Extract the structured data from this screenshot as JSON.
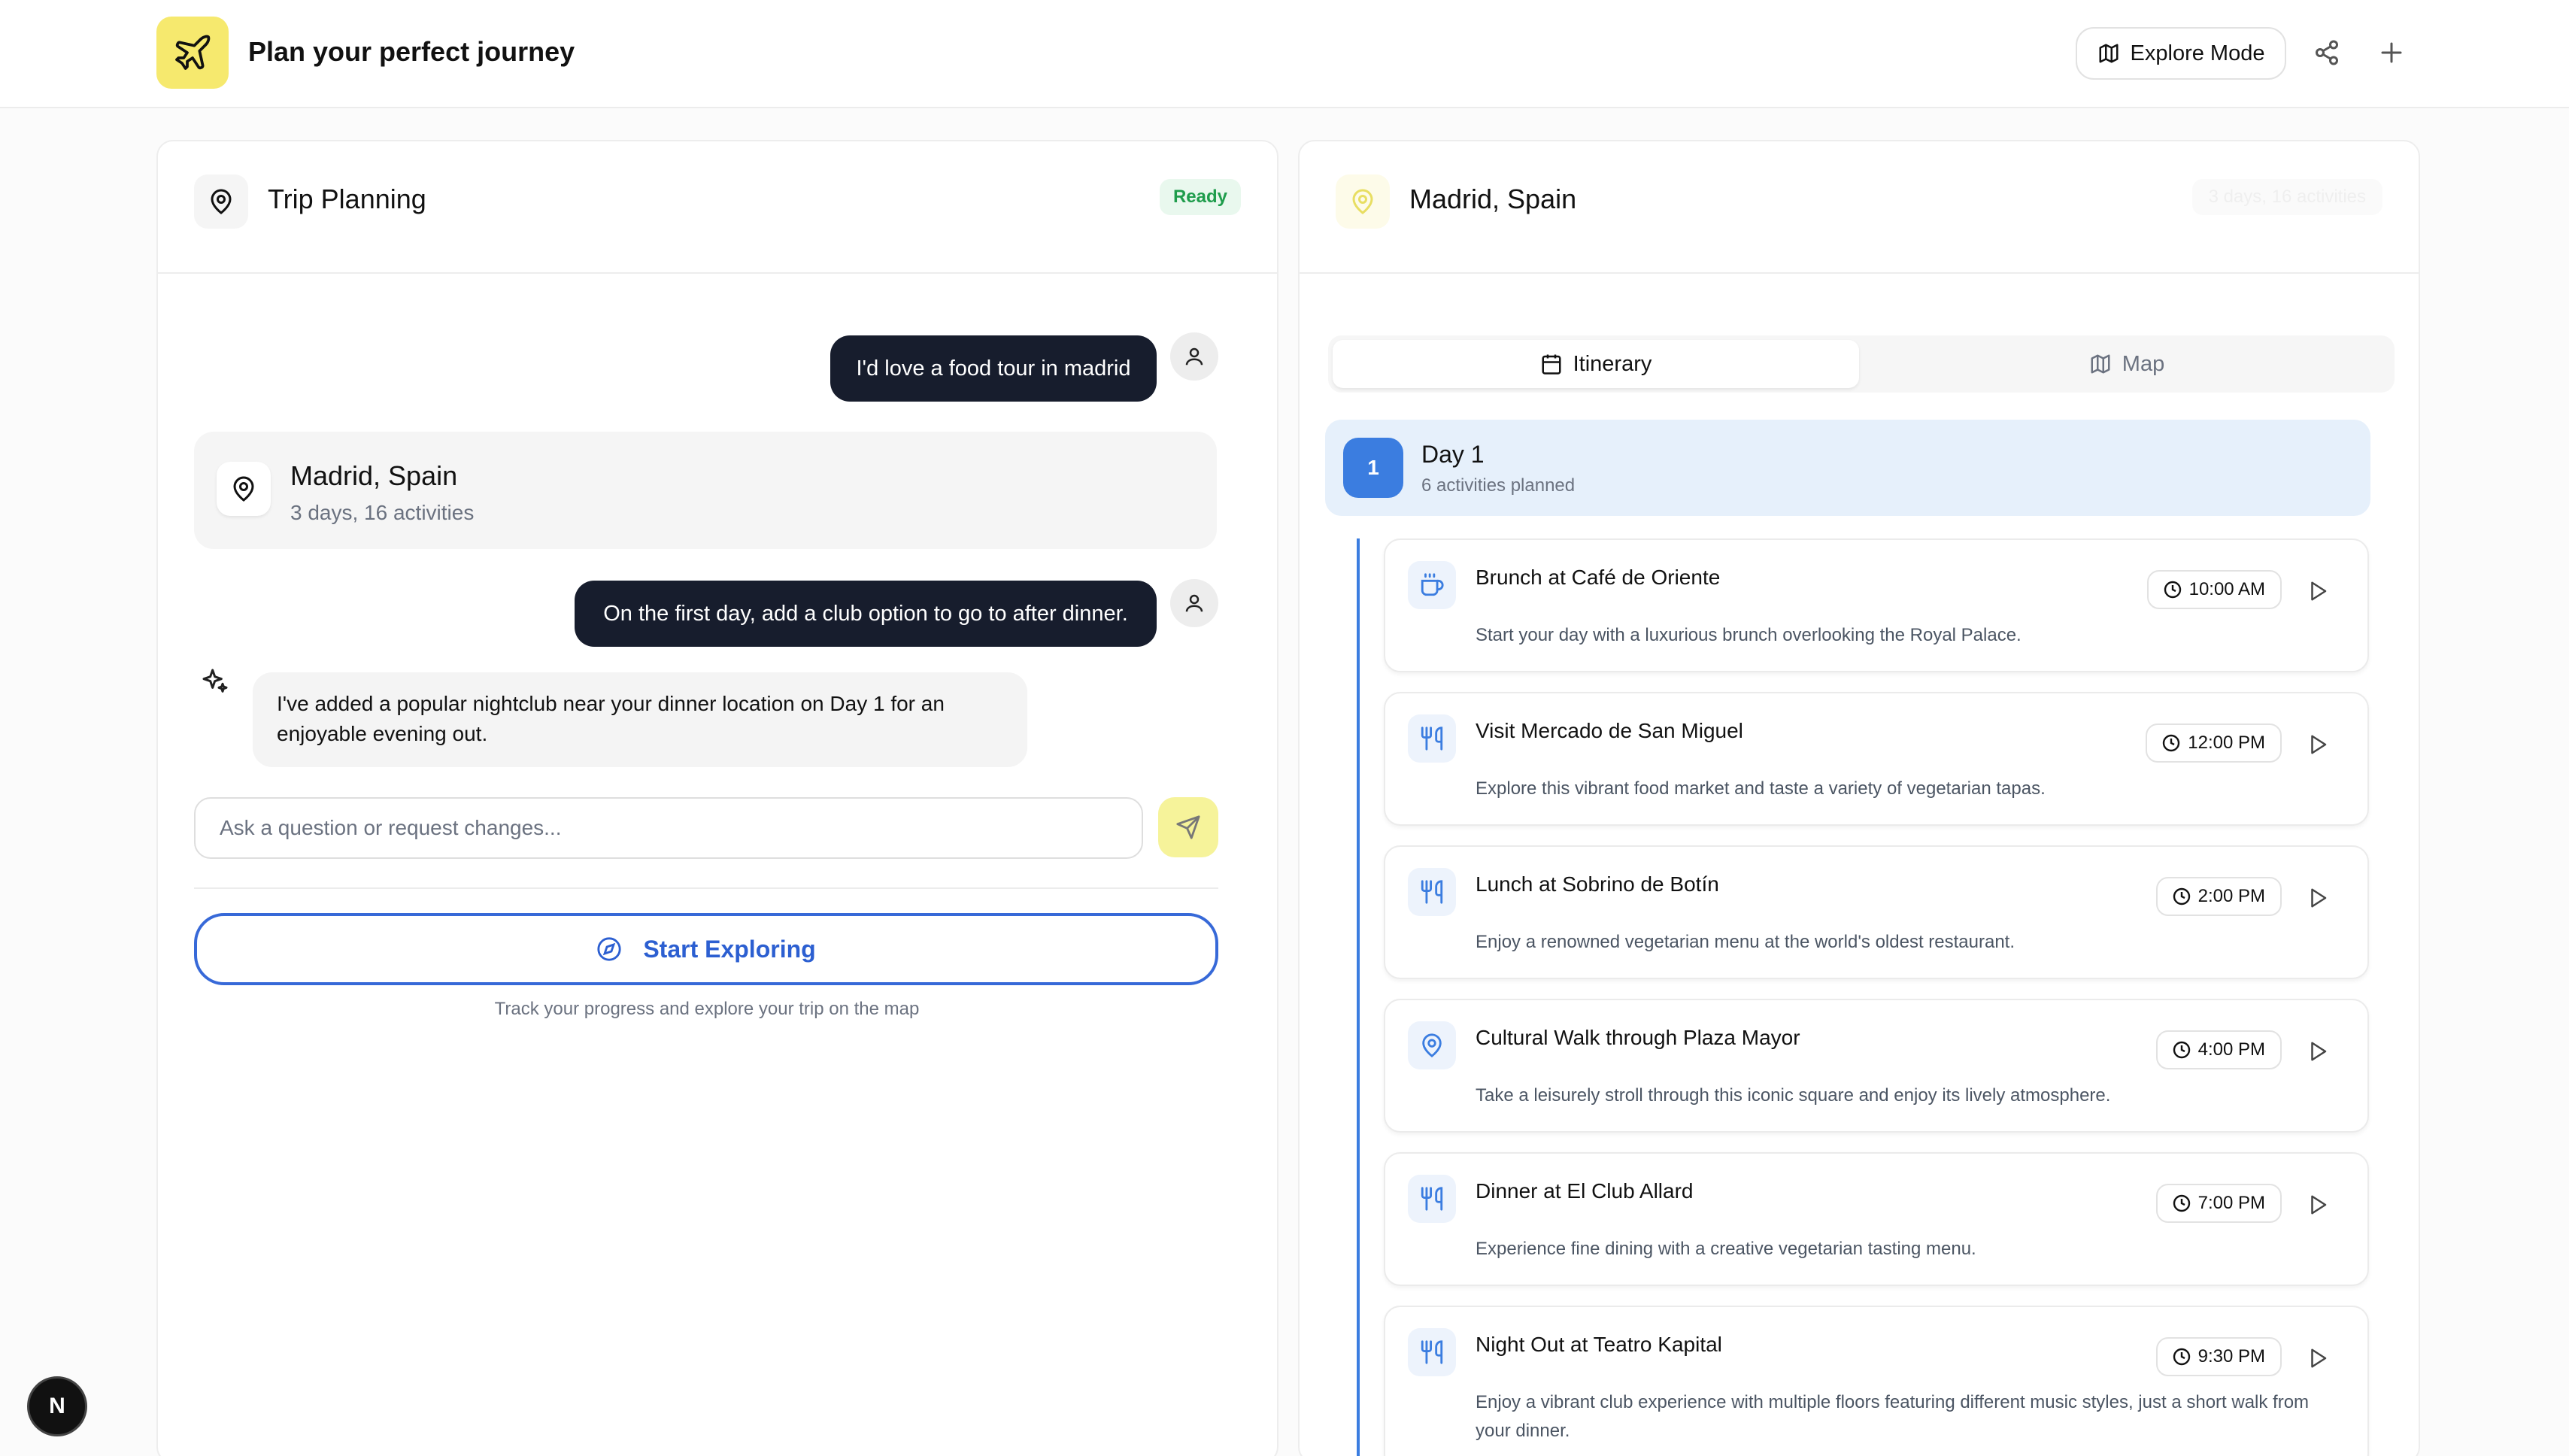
{
  "header": {
    "title": "Plan your perfect journey",
    "explore_mode_label": "Explore Mode",
    "logo_icon": "plane-icon",
    "share_icon": "share-icon",
    "add_icon": "plus-icon"
  },
  "chat_panel": {
    "title": "Trip Planning",
    "status_badge": "Ready",
    "messages": [
      {
        "role": "user",
        "text": "I'd love a food tour in madrid"
      },
      {
        "role": "assistant_card",
        "title": "Madrid, Spain",
        "subtitle": "3 days, 16 activities"
      },
      {
        "role": "user",
        "text": "On the first day, add a club option to go to after dinner."
      },
      {
        "role": "assistant",
        "text": "I've added a popular nightclub near your dinner location on Day 1 for an enjoyable evening out."
      }
    ],
    "input_placeholder": "Ask a question or request changes...",
    "start_button_label": "Start Exploring",
    "start_hint": "Track your progress and explore your trip on the map"
  },
  "itinerary_panel": {
    "title": "Madrid, Spain",
    "faint_badge": "3 days, 16 activities",
    "tabs": [
      {
        "label": "Itinerary",
        "active": true,
        "icon": "calendar-icon"
      },
      {
        "label": "Map",
        "active": false,
        "icon": "map-icon"
      }
    ],
    "day": {
      "number": "1",
      "title": "Day 1",
      "subtitle": "6 activities planned"
    },
    "activities": [
      {
        "title": "Brunch at Café de Oriente",
        "time": "10:00 AM",
        "description": "Start your day with a luxurious brunch overlooking the Royal Palace.",
        "icon": "coffee-icon"
      },
      {
        "title": "Visit Mercado de San Miguel",
        "time": "12:00 PM",
        "description": "Explore this vibrant food market and taste a variety of vegetarian tapas.",
        "icon": "utensils-icon"
      },
      {
        "title": "Lunch at Sobrino de Botín",
        "time": "2:00 PM",
        "description": "Enjoy a renowned vegetarian menu at the world's oldest restaurant.",
        "icon": "utensils-icon"
      },
      {
        "title": "Cultural Walk through Plaza Mayor",
        "time": "4:00 PM",
        "description": "Take a leisurely stroll through this iconic square and enjoy its lively atmosphere.",
        "icon": "map-pin-icon"
      },
      {
        "title": "Dinner at El Club Allard",
        "time": "7:00 PM",
        "description": "Experience fine dining with a creative vegetarian tasting menu.",
        "icon": "utensils-icon"
      },
      {
        "title": "Night Out at Teatro Kapital",
        "time": "9:30 PM",
        "description": "Enjoy a vibrant club experience with multiple floors featuring different music styles, just a short walk from your dinner.",
        "icon": "utensils-icon"
      }
    ]
  },
  "dev_badge": "N",
  "colors": {
    "accent_blue": "#3b7de0",
    "logo_yellow": "#f6e96e",
    "user_bubble": "#171d2d",
    "ready_green": "#1f9d4c"
  }
}
